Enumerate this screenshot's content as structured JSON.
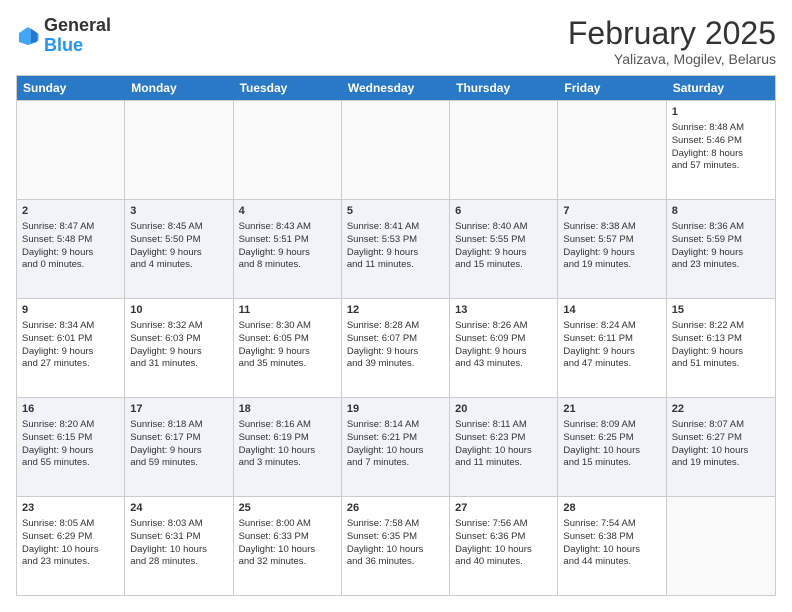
{
  "header": {
    "logo_general": "General",
    "logo_blue": "Blue",
    "month_title": "February 2025",
    "subtitle": "Yalizava, Mogilev, Belarus"
  },
  "days_of_week": [
    "Sunday",
    "Monday",
    "Tuesday",
    "Wednesday",
    "Thursday",
    "Friday",
    "Saturday"
  ],
  "weeks": [
    [
      {
        "day": "",
        "empty": true
      },
      {
        "day": "",
        "empty": true
      },
      {
        "day": "",
        "empty": true
      },
      {
        "day": "",
        "empty": true
      },
      {
        "day": "",
        "empty": true
      },
      {
        "day": "",
        "empty": true
      },
      {
        "day": "1",
        "lines": [
          "Sunrise: 8:48 AM",
          "Sunset: 5:46 PM",
          "Daylight: 8 hours",
          "and 57 minutes."
        ]
      }
    ],
    [
      {
        "day": "2",
        "lines": [
          "Sunrise: 8:47 AM",
          "Sunset: 5:48 PM",
          "Daylight: 9 hours",
          "and 0 minutes."
        ]
      },
      {
        "day": "3",
        "lines": [
          "Sunrise: 8:45 AM",
          "Sunset: 5:50 PM",
          "Daylight: 9 hours",
          "and 4 minutes."
        ]
      },
      {
        "day": "4",
        "lines": [
          "Sunrise: 8:43 AM",
          "Sunset: 5:51 PM",
          "Daylight: 9 hours",
          "and 8 minutes."
        ]
      },
      {
        "day": "5",
        "lines": [
          "Sunrise: 8:41 AM",
          "Sunset: 5:53 PM",
          "Daylight: 9 hours",
          "and 11 minutes."
        ]
      },
      {
        "day": "6",
        "lines": [
          "Sunrise: 8:40 AM",
          "Sunset: 5:55 PM",
          "Daylight: 9 hours",
          "and 15 minutes."
        ]
      },
      {
        "day": "7",
        "lines": [
          "Sunrise: 8:38 AM",
          "Sunset: 5:57 PM",
          "Daylight: 9 hours",
          "and 19 minutes."
        ]
      },
      {
        "day": "8",
        "lines": [
          "Sunrise: 8:36 AM",
          "Sunset: 5:59 PM",
          "Daylight: 9 hours",
          "and 23 minutes."
        ]
      }
    ],
    [
      {
        "day": "9",
        "lines": [
          "Sunrise: 8:34 AM",
          "Sunset: 6:01 PM",
          "Daylight: 9 hours",
          "and 27 minutes."
        ]
      },
      {
        "day": "10",
        "lines": [
          "Sunrise: 8:32 AM",
          "Sunset: 6:03 PM",
          "Daylight: 9 hours",
          "and 31 minutes."
        ]
      },
      {
        "day": "11",
        "lines": [
          "Sunrise: 8:30 AM",
          "Sunset: 6:05 PM",
          "Daylight: 9 hours",
          "and 35 minutes."
        ]
      },
      {
        "day": "12",
        "lines": [
          "Sunrise: 8:28 AM",
          "Sunset: 6:07 PM",
          "Daylight: 9 hours",
          "and 39 minutes."
        ]
      },
      {
        "day": "13",
        "lines": [
          "Sunrise: 8:26 AM",
          "Sunset: 6:09 PM",
          "Daylight: 9 hours",
          "and 43 minutes."
        ]
      },
      {
        "day": "14",
        "lines": [
          "Sunrise: 8:24 AM",
          "Sunset: 6:11 PM",
          "Daylight: 9 hours",
          "and 47 minutes."
        ]
      },
      {
        "day": "15",
        "lines": [
          "Sunrise: 8:22 AM",
          "Sunset: 6:13 PM",
          "Daylight: 9 hours",
          "and 51 minutes."
        ]
      }
    ],
    [
      {
        "day": "16",
        "lines": [
          "Sunrise: 8:20 AM",
          "Sunset: 6:15 PM",
          "Daylight: 9 hours",
          "and 55 minutes."
        ]
      },
      {
        "day": "17",
        "lines": [
          "Sunrise: 8:18 AM",
          "Sunset: 6:17 PM",
          "Daylight: 9 hours",
          "and 59 minutes."
        ]
      },
      {
        "day": "18",
        "lines": [
          "Sunrise: 8:16 AM",
          "Sunset: 6:19 PM",
          "Daylight: 10 hours",
          "and 3 minutes."
        ]
      },
      {
        "day": "19",
        "lines": [
          "Sunrise: 8:14 AM",
          "Sunset: 6:21 PM",
          "Daylight: 10 hours",
          "and 7 minutes."
        ]
      },
      {
        "day": "20",
        "lines": [
          "Sunrise: 8:11 AM",
          "Sunset: 6:23 PM",
          "Daylight: 10 hours",
          "and 11 minutes."
        ]
      },
      {
        "day": "21",
        "lines": [
          "Sunrise: 8:09 AM",
          "Sunset: 6:25 PM",
          "Daylight: 10 hours",
          "and 15 minutes."
        ]
      },
      {
        "day": "22",
        "lines": [
          "Sunrise: 8:07 AM",
          "Sunset: 6:27 PM",
          "Daylight: 10 hours",
          "and 19 minutes."
        ]
      }
    ],
    [
      {
        "day": "23",
        "lines": [
          "Sunrise: 8:05 AM",
          "Sunset: 6:29 PM",
          "Daylight: 10 hours",
          "and 23 minutes."
        ]
      },
      {
        "day": "24",
        "lines": [
          "Sunrise: 8:03 AM",
          "Sunset: 6:31 PM",
          "Daylight: 10 hours",
          "and 28 minutes."
        ]
      },
      {
        "day": "25",
        "lines": [
          "Sunrise: 8:00 AM",
          "Sunset: 6:33 PM",
          "Daylight: 10 hours",
          "and 32 minutes."
        ]
      },
      {
        "day": "26",
        "lines": [
          "Sunrise: 7:58 AM",
          "Sunset: 6:35 PM",
          "Daylight: 10 hours",
          "and 36 minutes."
        ]
      },
      {
        "day": "27",
        "lines": [
          "Sunrise: 7:56 AM",
          "Sunset: 6:36 PM",
          "Daylight: 10 hours",
          "and 40 minutes."
        ]
      },
      {
        "day": "28",
        "lines": [
          "Sunrise: 7:54 AM",
          "Sunset: 6:38 PM",
          "Daylight: 10 hours",
          "and 44 minutes."
        ]
      },
      {
        "day": "",
        "empty": true
      }
    ]
  ]
}
